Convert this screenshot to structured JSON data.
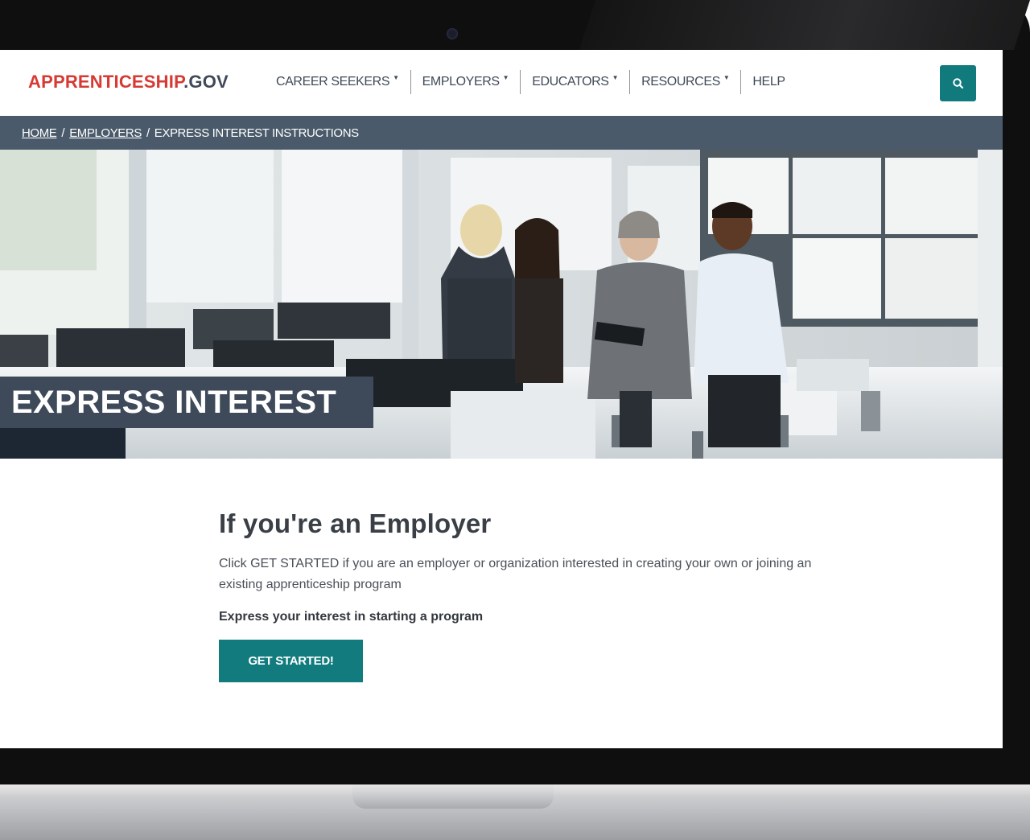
{
  "site": {
    "logo_main": "APPRENTICESHIP",
    "logo_suffix": ".GOV"
  },
  "nav": {
    "items": [
      {
        "label": "CAREER SEEKERS",
        "has_dropdown": true
      },
      {
        "label": "EMPLOYERS",
        "has_dropdown": true
      },
      {
        "label": "EDUCATORS",
        "has_dropdown": true
      },
      {
        "label": "RESOURCES",
        "has_dropdown": true
      },
      {
        "label": "HELP",
        "has_dropdown": false
      }
    ],
    "search_icon": "search-icon"
  },
  "breadcrumb": {
    "home": "HOME",
    "employers": "EMPLOYERS",
    "current": "EXPRESS INTEREST INSTRUCTIONS",
    "separator": "/"
  },
  "hero": {
    "title": "EXPRESS INTEREST",
    "image": "office-team-photo"
  },
  "main": {
    "heading": "If you're an Employer",
    "description": "Click GET STARTED if you are an employer or organization interested in creating your own or joining an existing apprenticeship program",
    "subheading": "Express your interest in starting a program",
    "cta_label": "GET STARTED!"
  },
  "colors": {
    "brand_red": "#d63a33",
    "brand_teal": "#117a7c",
    "breadcrumb_bg": "#4a5a6a",
    "hero_label_bg": "#3e4a5a"
  }
}
